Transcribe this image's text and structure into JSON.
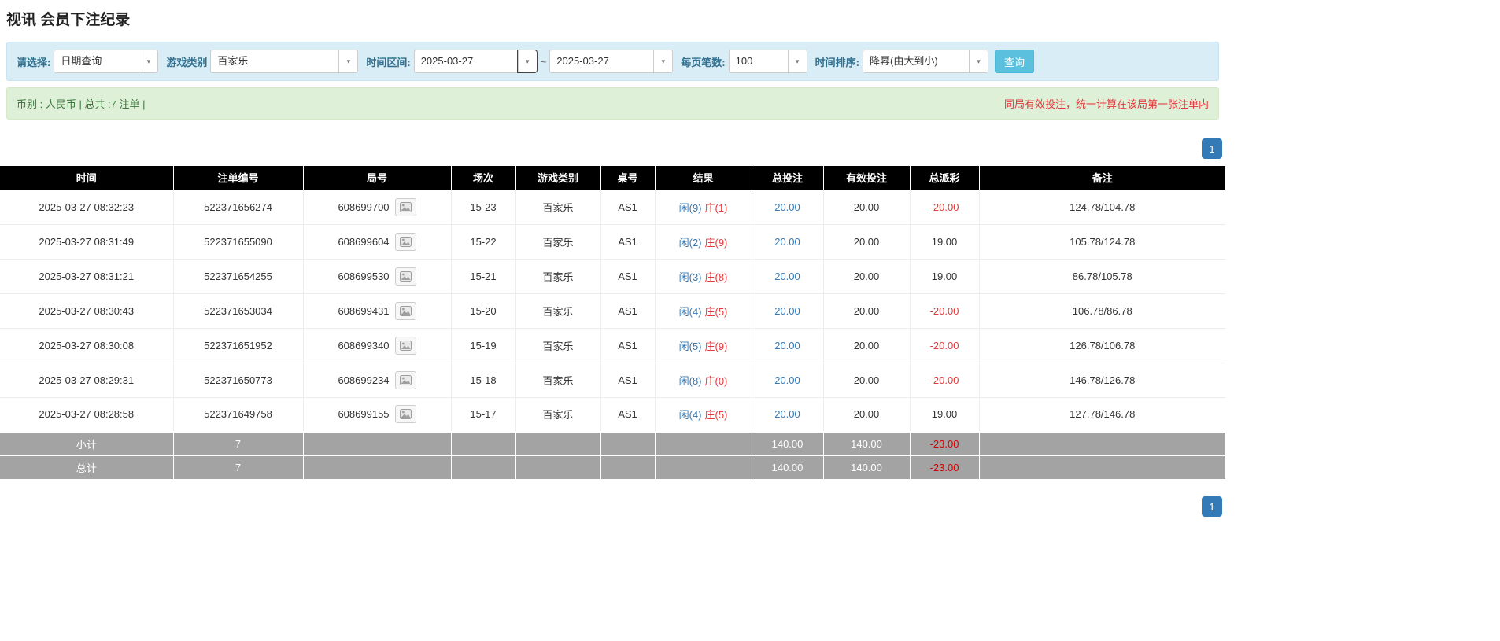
{
  "page": {
    "title": "视讯 会员下注纪录"
  },
  "filters": {
    "select_label": "请选择:",
    "select_value": "日期查询",
    "game_type_label": "游戏类别",
    "game_type_value": "百家乐",
    "date_range_label": "时间区间:",
    "date_from": "2025-03-27",
    "date_separator": "~",
    "date_to": "2025-03-27",
    "page_size_label": "每页笔数:",
    "page_size_value": "100",
    "sort_label": "时间排序:",
    "sort_value": "降幂(由大到小)",
    "search_button": "查询"
  },
  "info_bar": {
    "left": "币别 : 人民币 | 总共 :7 注单 |",
    "right": "同局有效投注，统一计算在该局第一张注单内"
  },
  "pagination": {
    "page": "1"
  },
  "colors": {
    "accent": "#337ab7",
    "red": "#e4393c",
    "header_bg": "#000000",
    "footer_bg": "#a3a3a3",
    "filter_bg": "#d9edf7",
    "info_bg": "#dff0d8",
    "button_bg": "#5bc0de"
  },
  "table": {
    "headers": [
      "时间",
      "注单编号",
      "局号",
      "场次",
      "游戏类别",
      "桌号",
      "结果",
      "总投注",
      "有效投注",
      "总派彩",
      "备注"
    ],
    "rows": [
      {
        "time": "2025-03-27 08:32:23",
        "bet_id": "522371656274",
        "round_id": "608699700",
        "session": "15-23",
        "game": "百家乐",
        "table_no": "AS1",
        "result_player": "闲(9)",
        "result_banker": "庄(1)",
        "total_bet": "20.00",
        "valid_bet": "20.00",
        "payout": "-20.00",
        "remark": "124.78/104.78"
      },
      {
        "time": "2025-03-27 08:31:49",
        "bet_id": "522371655090",
        "round_id": "608699604",
        "session": "15-22",
        "game": "百家乐",
        "table_no": "AS1",
        "result_player": "闲(2)",
        "result_banker": "庄(9)",
        "total_bet": "20.00",
        "valid_bet": "20.00",
        "payout": "19.00",
        "remark": "105.78/124.78"
      },
      {
        "time": "2025-03-27 08:31:21",
        "bet_id": "522371654255",
        "round_id": "608699530",
        "session": "15-21",
        "game": "百家乐",
        "table_no": "AS1",
        "result_player": "闲(3)",
        "result_banker": "庄(8)",
        "total_bet": "20.00",
        "valid_bet": "20.00",
        "payout": "19.00",
        "remark": "86.78/105.78"
      },
      {
        "time": "2025-03-27 08:30:43",
        "bet_id": "522371653034",
        "round_id": "608699431",
        "session": "15-20",
        "game": "百家乐",
        "table_no": "AS1",
        "result_player": "闲(4)",
        "result_banker": "庄(5)",
        "total_bet": "20.00",
        "valid_bet": "20.00",
        "payout": "-20.00",
        "remark": "106.78/86.78"
      },
      {
        "time": "2025-03-27 08:30:08",
        "bet_id": "522371651952",
        "round_id": "608699340",
        "session": "15-19",
        "game": "百家乐",
        "table_no": "AS1",
        "result_player": "闲(5)",
        "result_banker": "庄(9)",
        "total_bet": "20.00",
        "valid_bet": "20.00",
        "payout": "-20.00",
        "remark": "126.78/106.78"
      },
      {
        "time": "2025-03-27 08:29:31",
        "bet_id": "522371650773",
        "round_id": "608699234",
        "session": "15-18",
        "game": "百家乐",
        "table_no": "AS1",
        "result_player": "闲(8)",
        "result_banker": "庄(0)",
        "total_bet": "20.00",
        "valid_bet": "20.00",
        "payout": "-20.00",
        "remark": "146.78/126.78"
      },
      {
        "time": "2025-03-27 08:28:58",
        "bet_id": "522371649758",
        "round_id": "608699155",
        "session": "15-17",
        "game": "百家乐",
        "table_no": "AS1",
        "result_player": "闲(4)",
        "result_banker": "庄(5)",
        "total_bet": "20.00",
        "valid_bet": "20.00",
        "payout": "19.00",
        "remark": "127.78/146.78"
      }
    ],
    "subtotal": {
      "label": "小计",
      "count": "7",
      "total_bet": "140.00",
      "valid_bet": "140.00",
      "payout": "-23.00",
      "remark": ""
    },
    "total": {
      "label": "总计",
      "count": "7",
      "total_bet": "140.00",
      "valid_bet": "140.00",
      "payout": "-23.00",
      "remark": ""
    }
  }
}
